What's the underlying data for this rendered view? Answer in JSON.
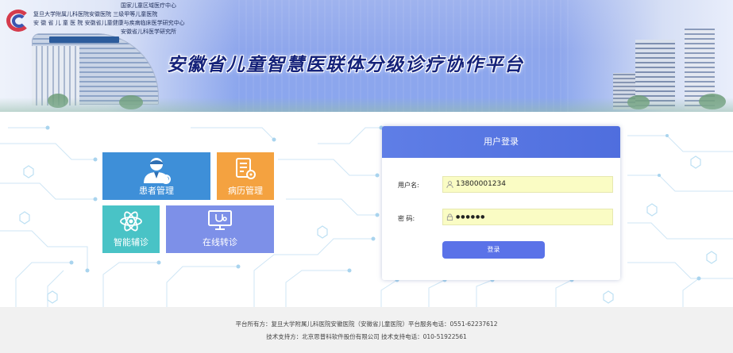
{
  "header": {
    "hospital_lines": [
      "国家儿童区域医疗中心",
      "复旦大学附属儿科医院安徽医院  三级甲等儿童医院",
      "安 徽 省 儿 童 医 院  安徽省儿童健康与疾病临床医学研究中心",
      "安徽省儿科医学研究所"
    ],
    "platform_title": "安徽省儿童智慧医联体分级诊疗协作平台"
  },
  "tiles": {
    "patient": "患者管理",
    "record": "病历管理",
    "smart": "智能辅诊",
    "online": "在线转诊"
  },
  "login": {
    "title": "用户登录",
    "username_label": "用户名:",
    "username_value": "13800001234",
    "password_label": "密    码:",
    "password_value": "●●●●●●",
    "submit_label": "登录"
  },
  "footer": {
    "line1": "平台所有方：复旦大学附属儿科医院安徽医院（安徽省儿童医院）平台服务电话：0551-62237612",
    "line2": "技术支持方：北京思普科软件股份有限公司  技术支持电话：010-51922561"
  },
  "colors": {
    "title": "#16237a",
    "tile_patient": "#3e8fd8",
    "tile_record": "#f4a240",
    "tile_smart": "#49c3c6",
    "tile_online": "#7d90e8",
    "login_header": "#5f7ee6",
    "login_button": "#5a72e8",
    "input_bg": "#fafcc4"
  },
  "icons": [
    "doctor-icon",
    "document-gear-icon",
    "atom-icon",
    "monitor-stethoscope-icon",
    "user-icon",
    "lock-icon",
    "hospital-logo-icon"
  ]
}
